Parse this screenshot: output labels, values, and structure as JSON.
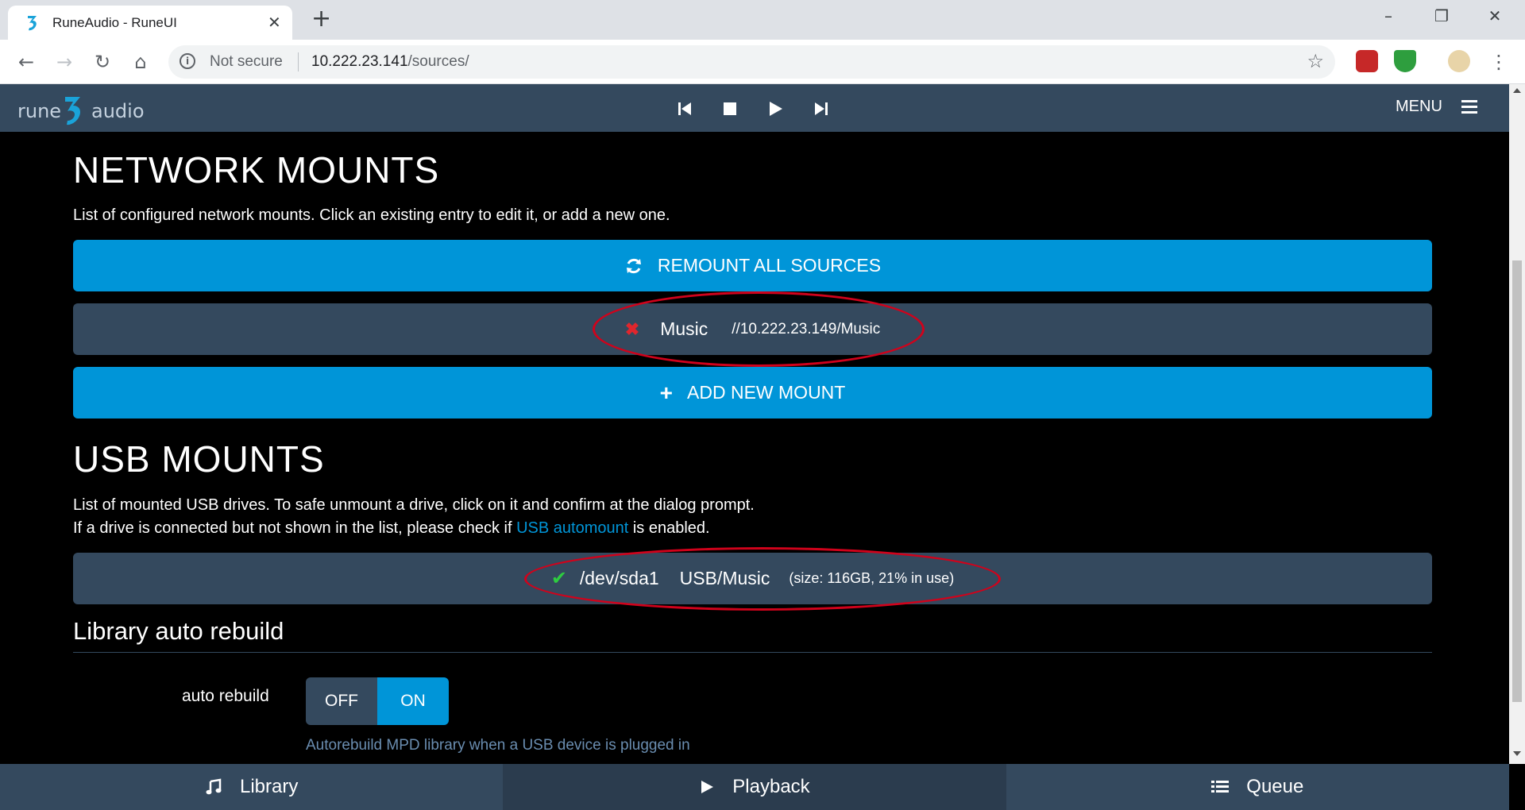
{
  "browser": {
    "tab_title": "RuneAudio - RuneUI",
    "tab_close": "✕",
    "new_tab": "+",
    "not_secure": "Not secure",
    "url_host": "10.222.23.141",
    "url_path": "/sources/"
  },
  "header": {
    "logo_left": "rune",
    "logo_right": "audio",
    "menu_label": "MENU"
  },
  "network": {
    "title": "NETWORK MOUNTS",
    "description": "List of configured network mounts. Click an existing entry to edit it, or add a new one.",
    "remount_label": "REMOUNT ALL SOURCES",
    "mount_name": "Music",
    "mount_path": "//10.222.23.149/Music",
    "add_label": "ADD NEW MOUNT"
  },
  "usb": {
    "title": "USB MOUNTS",
    "description_line1": "List of mounted USB drives. To safe unmount a drive, click on it and confirm at the dialog prompt.",
    "description_line2_pre": "If a drive is connected but not shown in the list, please check if ",
    "description_link": "USB automount",
    "description_line2_post": " is enabled.",
    "device": "/dev/sda1",
    "mount_name": "USB/Music",
    "details": "(size: 116GB,  21% in use)"
  },
  "library": {
    "title": "Library auto rebuild",
    "label": "auto rebuild",
    "off_label": "OFF",
    "on_label": "ON",
    "selected": "ON",
    "help": "Autorebuild MPD library when a USB device is plugged in"
  },
  "bottom_nav": {
    "library": "Library",
    "playback": "Playback",
    "queue": "Queue",
    "active": "Playback"
  },
  "colors": {
    "accent": "#0095d8",
    "panel": "#34495e",
    "error": "#d0021b",
    "ok": "#2ecc40"
  }
}
